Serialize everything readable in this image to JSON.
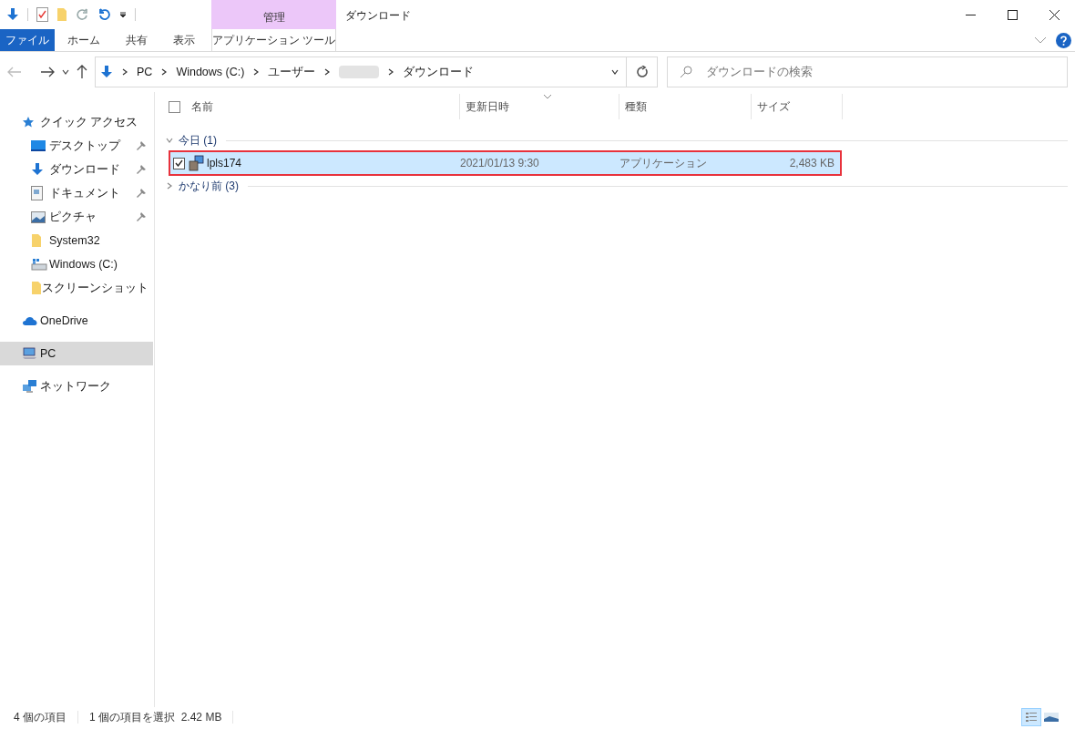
{
  "window": {
    "title": "ダウンロード"
  },
  "ribbon": {
    "context_group": "管理",
    "tabs": [
      {
        "label": "ファイル",
        "kind": "file",
        "selected": false
      },
      {
        "label": "ホーム",
        "kind": "tab",
        "selected": false
      },
      {
        "label": "共有",
        "kind": "tab",
        "selected": false
      },
      {
        "label": "表示",
        "kind": "tab",
        "selected": false
      },
      {
        "label": "アプリケーション ツール",
        "kind": "context",
        "selected": false
      }
    ]
  },
  "address": {
    "crumbs": [
      {
        "label": "PC",
        "kind": "text"
      },
      {
        "label": "Windows (C:)",
        "kind": "text"
      },
      {
        "label": "ユーザー",
        "kind": "text"
      },
      {
        "kind": "hidden"
      },
      {
        "label": "ダウンロード",
        "kind": "text"
      }
    ],
    "back_disabled": true
  },
  "search": {
    "placeholder": "ダウンロードの検索"
  },
  "sidebar": {
    "items": [
      {
        "label": "クイック アクセス",
        "kind": "star",
        "selected": false,
        "children": [
          {
            "label": "デスクトップ",
            "kind": "desktop",
            "pinned": true,
            "selected": false
          },
          {
            "label": "ダウンロード",
            "kind": "download",
            "pinned": true,
            "selected": false
          },
          {
            "label": "ドキュメント",
            "kind": "document",
            "pinned": true,
            "selected": false
          },
          {
            "label": "ピクチャ",
            "kind": "picture",
            "pinned": true,
            "selected": false
          },
          {
            "label": "System32",
            "kind": "folder",
            "pinned": false,
            "selected": false
          },
          {
            "label": "Windows (C:)",
            "kind": "drive",
            "pinned": false,
            "selected": false
          },
          {
            "label": "スクリーンショット",
            "kind": "folder",
            "pinned": false,
            "selected": false
          }
        ]
      },
      {
        "label": "OneDrive",
        "kind": "cloud",
        "selected": false
      },
      {
        "label": "PC",
        "kind": "pc",
        "selected": true
      },
      {
        "label": "ネットワーク",
        "kind": "network",
        "selected": false
      }
    ]
  },
  "table": {
    "columns": [
      "名前",
      "更新日時",
      "種類",
      "サイズ"
    ],
    "select_all_checked": false,
    "groups": [
      {
        "label": "今日 (1)",
        "expanded": true,
        "rows": [
          {
            "name": "lpls174",
            "date": "2021/01/13 9:30",
            "type": "アプリケーション",
            "size": "2,483 KB",
            "selected": true,
            "checked": true,
            "highlighted": true
          }
        ]
      },
      {
        "label": "かなり前 (3)",
        "expanded": false
      }
    ]
  },
  "status_bar": {
    "count": "4 個の項目",
    "selection": "1 個の項目を選択  2.42 MB"
  },
  "views": [
    {
      "kind": "details",
      "selected": true
    },
    {
      "kind": "tiles",
      "selected": false
    }
  ]
}
